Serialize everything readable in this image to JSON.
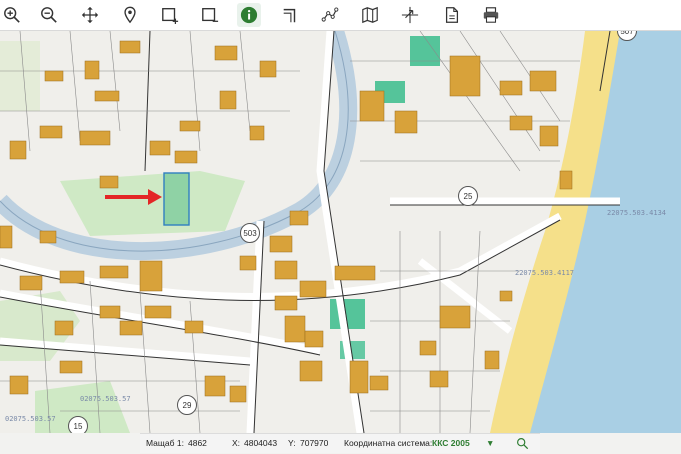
{
  "toolbar": {
    "tools": [
      {
        "icon": "zoom-in-icon"
      },
      {
        "icon": "zoom-out-icon"
      },
      {
        "icon": "pan-icon"
      },
      {
        "icon": "location-pin-icon"
      },
      {
        "icon": "add-area-icon"
      },
      {
        "icon": "remove-area-icon"
      },
      {
        "icon": "info-icon",
        "active": true
      },
      {
        "icon": "measure-angle-icon"
      },
      {
        "icon": "route-icon"
      },
      {
        "icon": "map-layers-icon"
      },
      {
        "icon": "coordinates-icon"
      },
      {
        "icon": "document-icon"
      },
      {
        "icon": "print-icon"
      }
    ]
  },
  "map": {
    "road_badges": [
      "503",
      "25",
      "29",
      "15",
      "507"
    ],
    "parcel_ids": [
      "22075.503.4134",
      "22075.503.4117",
      "02075.503.57",
      "02075.503.57"
    ],
    "colors": {
      "building": "#d8a23a",
      "park": "#b9e3b0",
      "sea": "#a9cfe4",
      "beach": "#f5e08a",
      "highlight": "#55c49a",
      "arrow": "#e32626",
      "blue_road": "#bcd0e0"
    }
  },
  "status": {
    "scale_label": "Мащаб 1:",
    "scale_value": "4862",
    "x_label": "X:",
    "x_value": "4804043",
    "y_label": "Y:",
    "y_value": "707970",
    "crs_label": "Координатна система:",
    "crs_value": "ККС 2005"
  }
}
